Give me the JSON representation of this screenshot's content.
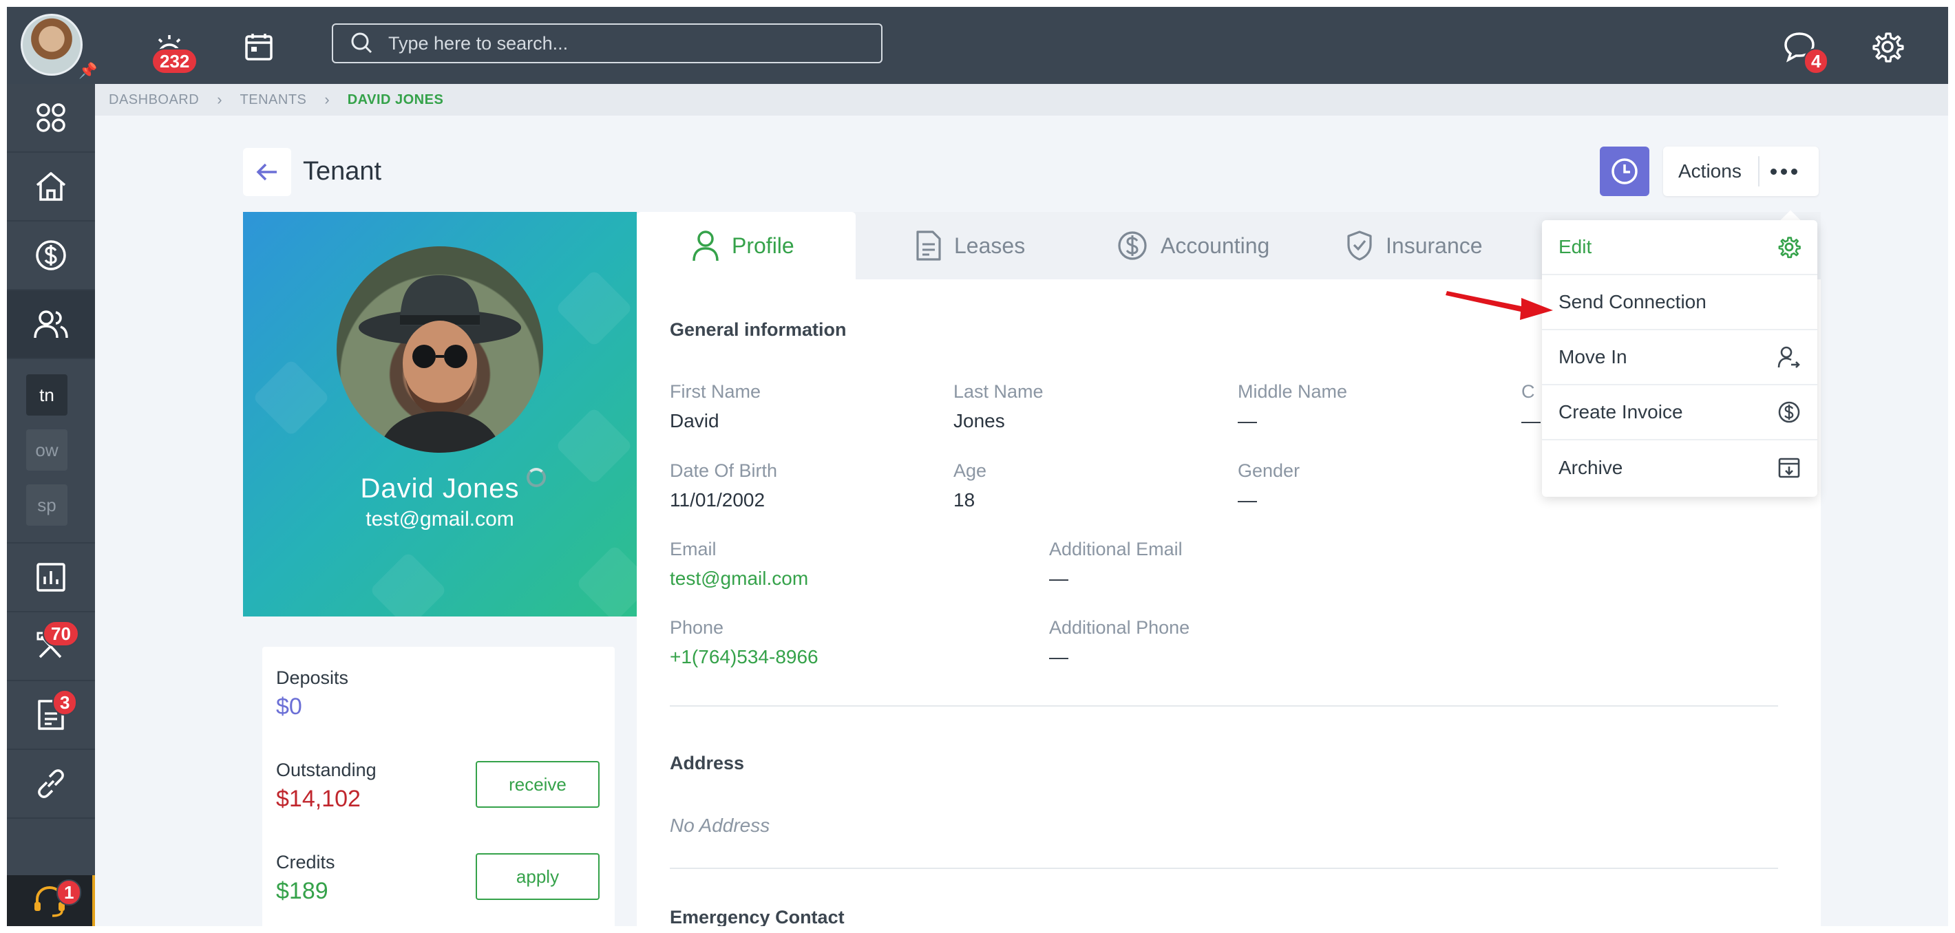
{
  "topbar": {
    "alerts_badge": "232",
    "messages_badge": "4",
    "search_placeholder": "Type here to search..."
  },
  "breadcrumb": [
    "DASHBOARD",
    "TENANTS",
    "DAVID JONES"
  ],
  "sidebar": {
    "chips": [
      "tn",
      "ow",
      "sp"
    ],
    "maintenance_badge": "70",
    "documents_badge": "3",
    "support_badge": "1"
  },
  "header": {
    "title": "Tenant",
    "actions_label": "Actions"
  },
  "profile": {
    "name": "David Jones",
    "email": "test@gmail.com"
  },
  "balances": {
    "deposits_label": "Deposits",
    "deposits_value": "$0",
    "outstanding_label": "Outstanding",
    "outstanding_value": "$14,102",
    "receive_label": "receive",
    "credits_label": "Credits",
    "credits_value": "$189",
    "apply_label": "apply"
  },
  "tabs": [
    "Profile",
    "Leases",
    "Accounting",
    "Insurance"
  ],
  "general": {
    "title": "General information",
    "first_name_label": "First Name",
    "first_name": "David",
    "last_name_label": "Last Name",
    "last_name": "Jones",
    "middle_name_label": "Middle Name",
    "middle_name": "—",
    "cut_label": "C",
    "cut_value": "—",
    "dob_label": "Date Of Birth",
    "dob": "11/01/2002",
    "age_label": "Age",
    "age": "18",
    "gender_label": "Gender",
    "gender": "—",
    "email_label": "Email",
    "email": "test@gmail.com",
    "additional_email_label": "Additional Email",
    "additional_email": "—",
    "phone_label": "Phone",
    "phone": "+1(764)534-8966",
    "additional_phone_label": "Additional Phone",
    "additional_phone": "—"
  },
  "address": {
    "title": "Address",
    "value": "No Address"
  },
  "emergency": {
    "title": "Emergency Contact"
  },
  "dropdown": {
    "items": [
      "Edit",
      "Send Connection",
      "Move In",
      "Create Invoice",
      "Archive"
    ]
  },
  "colors": {
    "accent_green": "#35a24a",
    "danger_red": "#c0262d",
    "primary_purple": "#6b6fd6",
    "topbar": "#3b4652",
    "badge_red": "#e5353d"
  }
}
